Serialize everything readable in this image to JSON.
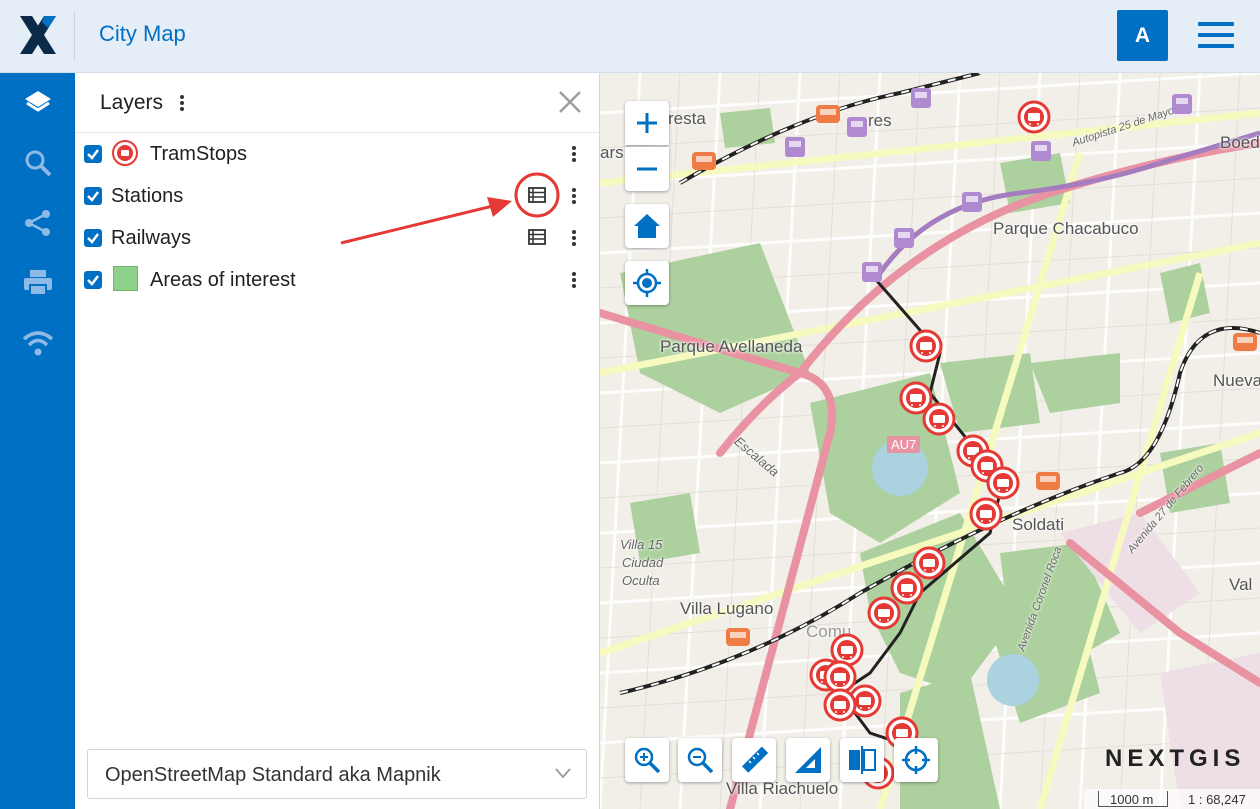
{
  "header": {
    "app_title": "City Map",
    "avatar_letter": "A"
  },
  "iconbar": {
    "items": [
      {
        "name": "layers-icon"
      },
      {
        "name": "search-icon"
      },
      {
        "name": "share-icon"
      },
      {
        "name": "print-icon"
      },
      {
        "name": "wifi-icon"
      }
    ]
  },
  "layers_panel": {
    "title": "Layers",
    "layers": [
      {
        "label": "TramStops",
        "checked": true,
        "swatch": "tram-stop-icon",
        "has_table": false
      },
      {
        "label": "Stations",
        "checked": true,
        "swatch": "",
        "has_table": true
      },
      {
        "label": "Railways",
        "checked": true,
        "swatch": "",
        "has_table": true
      },
      {
        "label": "Areas of interest",
        "checked": true,
        "swatch": "#8fd18a",
        "has_table": false
      }
    ],
    "basemap": "OpenStreetMap Standard aka Mapnik"
  },
  "map": {
    "labels": {
      "parque_chacabuco": "Parque Chacabuco",
      "parque_avellaneda": "Parque Avellaneda",
      "soldati": "Soldati",
      "villa_lugano": "Villa Lugano",
      "villa_riachuelo": "Villa Riachuelo",
      "nueva": "Nueva",
      "resta": "resta",
      "ars": "ars",
      "res": "res",
      "boedo": "Boed",
      "au7": "AU7",
      "comu": "Comu",
      "val": "Val",
      "escalada": "Escalada",
      "villa15": "Villa 15",
      "ciudad": "Ciudad",
      "oculta": "Oculta",
      "autopista": "Autopista 25 de Mayo",
      "av27": "Avenida 27 de Febrero",
      "corvalan": "Avenida Coronel Roca"
    },
    "brand": "NEXTGIS",
    "scale_label": "1000 m",
    "scale_ratio": "1 : 68,247",
    "accent": "#0070c5",
    "tram_color": "#e53935"
  }
}
